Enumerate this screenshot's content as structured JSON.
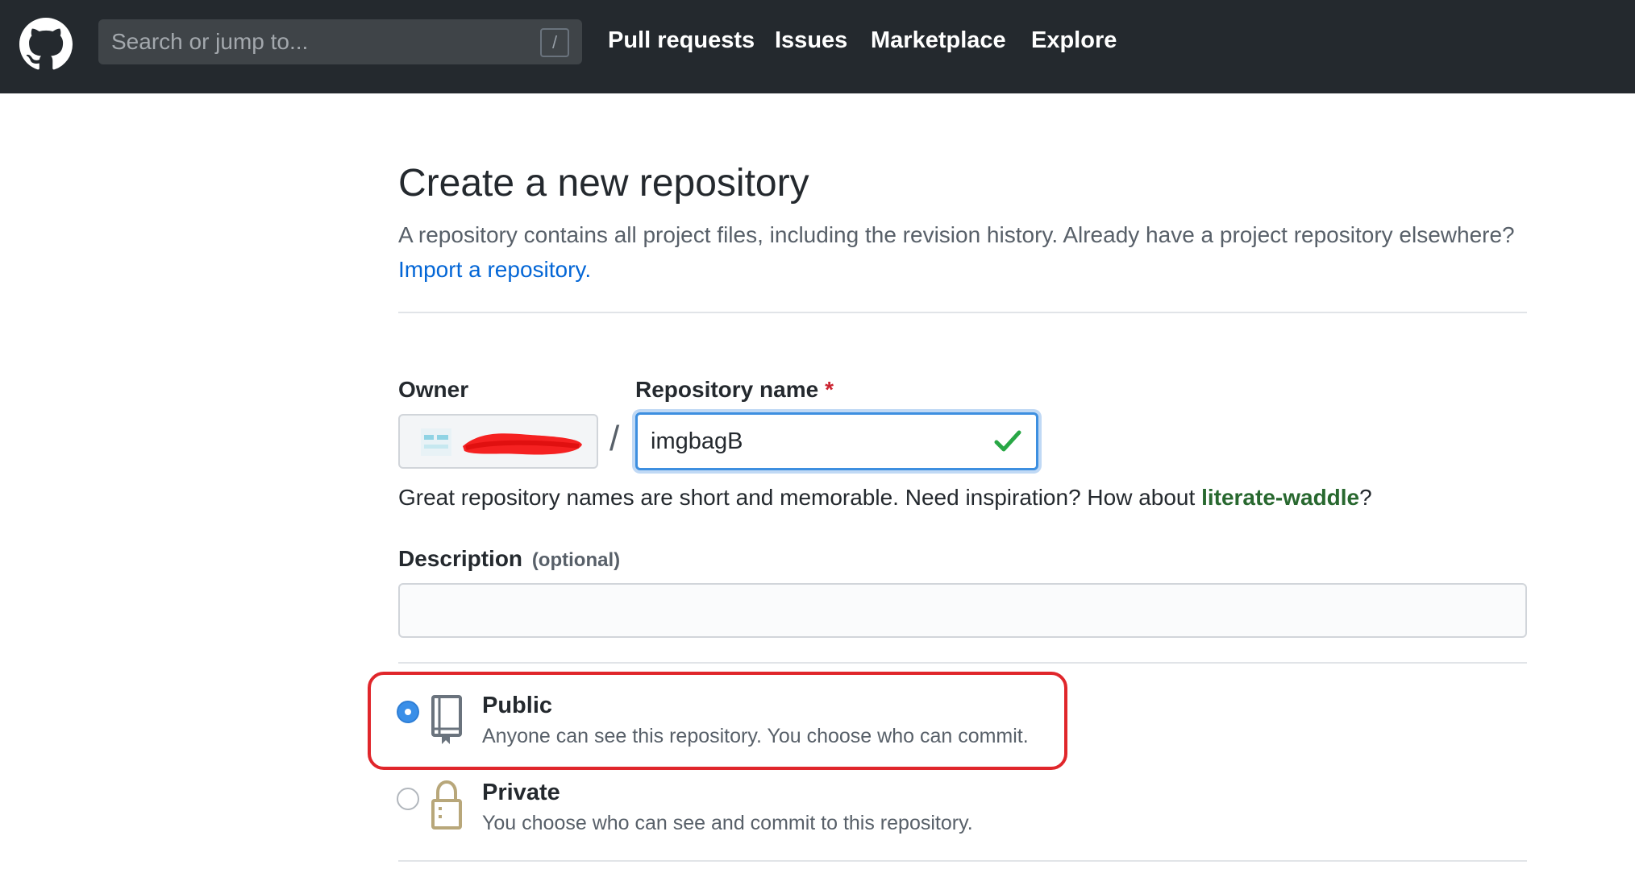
{
  "header": {
    "search": {
      "placeholder": "Search or jump to...",
      "shortcut": "/"
    },
    "nav": [
      "Pull requests",
      "Issues",
      "Marketplace",
      "Explore"
    ]
  },
  "page": {
    "title": "Create a new repository",
    "subtitle_text": "A repository contains all project files, including the revision history. Already have a project repository elsewhere?",
    "import_link": "Import a repository."
  },
  "form": {
    "owner_label": "Owner",
    "repo_label": "Repository name",
    "required_mark": "*",
    "slash": "/",
    "repo_value": "imgbagB",
    "hint_prefix": "Great repository names are short and memorable. Need inspiration? How about",
    "hint_suggestion": "literate-waddle",
    "hint_suffix": "?",
    "description_label": "Description",
    "description_optional": "(optional)",
    "description_value": ""
  },
  "visibility": {
    "public": {
      "title": "Public",
      "desc": "Anyone can see this repository. You choose who can commit.",
      "selected": true
    },
    "private": {
      "title": "Private",
      "desc": "You choose who can see and commit to this repository.",
      "selected": false
    }
  },
  "colors": {
    "header_bg": "#24292e",
    "link": "#0366d6",
    "suggestion": "#28682f",
    "highlight": "#e0262b",
    "radio_selected": "#3a8fe8",
    "valid_check": "#28a745"
  }
}
